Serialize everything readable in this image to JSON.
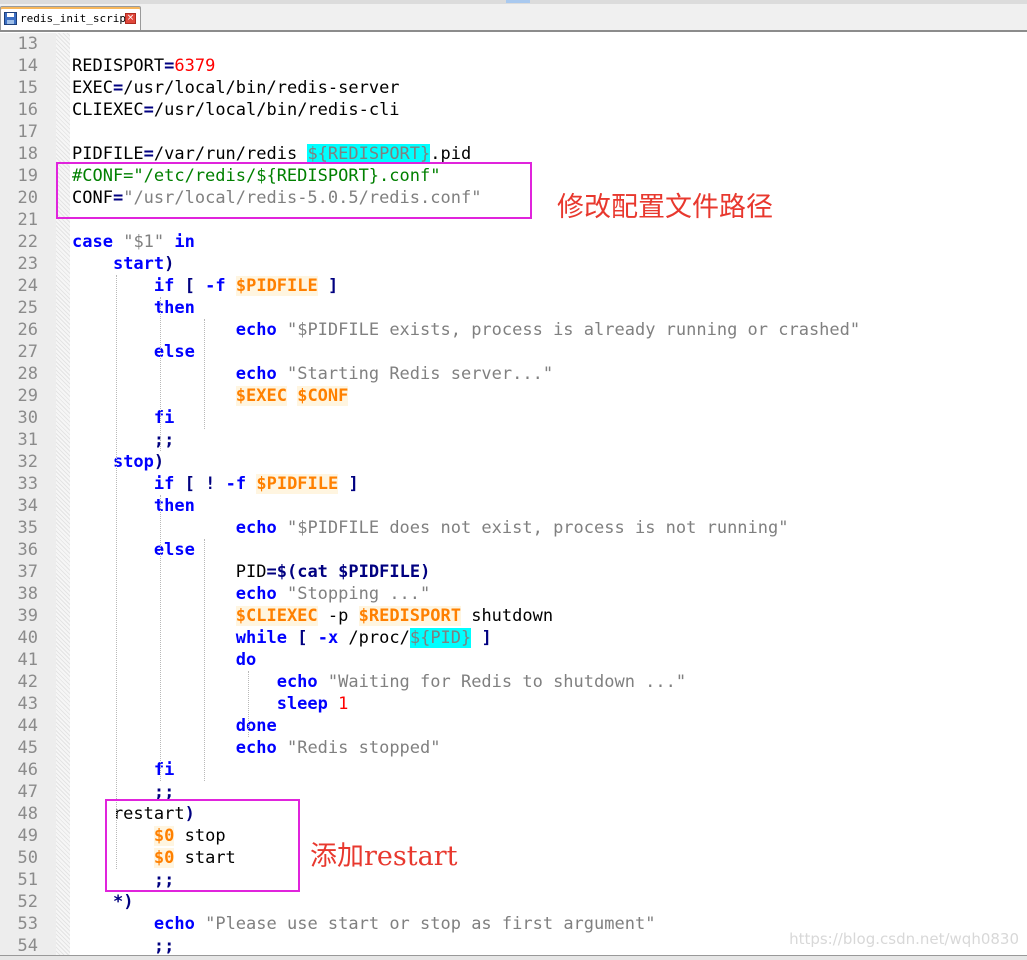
{
  "tab": {
    "title": "redis_init_script",
    "close_glyph": "×"
  },
  "icons": {
    "save": "save-icon",
    "close": "close-icon"
  },
  "lines": [
    {
      "n": "13",
      "tokens": []
    },
    {
      "n": "14",
      "tokens": [
        {
          "t": "REDISPORT"
        },
        {
          "t": "=",
          "c": "op"
        },
        {
          "t": "6379",
          "c": "num"
        }
      ]
    },
    {
      "n": "15",
      "tokens": [
        {
          "t": "EXEC"
        },
        {
          "t": "=",
          "c": "op"
        },
        {
          "t": "/usr/local/bin/redis-server"
        }
      ]
    },
    {
      "n": "16",
      "tokens": [
        {
          "t": "CLIEXEC"
        },
        {
          "t": "=",
          "c": "op"
        },
        {
          "t": "/usr/local/bin/redis-cli"
        }
      ]
    },
    {
      "n": "17",
      "tokens": []
    },
    {
      "n": "18",
      "tokens": [
        {
          "t": "PIDFILE"
        },
        {
          "t": "=",
          "c": "op"
        },
        {
          "t": "/var/run/redis "
        },
        {
          "t": "${REDISPORT}",
          "c": "hl"
        },
        {
          "t": ".pid"
        }
      ]
    },
    {
      "n": "19",
      "tokens": [
        {
          "t": "#CONF=\"/etc/redis/${REDISPORT}.conf\"",
          "c": "cmt"
        }
      ]
    },
    {
      "n": "20",
      "tokens": [
        {
          "t": "CONF"
        },
        {
          "t": "=",
          "c": "op"
        },
        {
          "t": "\"/usr/local/redis-5.0.5/redis.conf\"",
          "c": "str"
        }
      ]
    },
    {
      "n": "21",
      "tokens": []
    },
    {
      "n": "22",
      "tokens": [
        {
          "t": "case",
          "c": "kw"
        },
        {
          "t": " "
        },
        {
          "t": "\"$1\"",
          "c": "str"
        },
        {
          "t": " "
        },
        {
          "t": "in",
          "c": "kw"
        }
      ]
    },
    {
      "n": "23",
      "tokens": [
        {
          "t": "    "
        },
        {
          "t": "start",
          "c": "kw"
        },
        {
          "t": ")",
          "c": "op"
        }
      ]
    },
    {
      "n": "24",
      "tokens": [
        {
          "t": "        "
        },
        {
          "t": "if",
          "c": "kw"
        },
        {
          "t": " "
        },
        {
          "t": "[",
          "c": "op"
        },
        {
          "t": " "
        },
        {
          "t": "-f",
          "c": "kw"
        },
        {
          "t": " "
        },
        {
          "t": "$PIDFILE",
          "c": "var"
        },
        {
          "t": " "
        },
        {
          "t": "]",
          "c": "op"
        }
      ]
    },
    {
      "n": "25",
      "tokens": [
        {
          "t": "        "
        },
        {
          "t": "then",
          "c": "kw"
        }
      ]
    },
    {
      "n": "26",
      "tokens": [
        {
          "t": "                "
        },
        {
          "t": "echo",
          "c": "kw"
        },
        {
          "t": " "
        },
        {
          "t": "\"$PIDFILE exists, process is already running or crashed\"",
          "c": "str"
        }
      ]
    },
    {
      "n": "27",
      "tokens": [
        {
          "t": "        "
        },
        {
          "t": "else",
          "c": "kw"
        }
      ]
    },
    {
      "n": "28",
      "tokens": [
        {
          "t": "                "
        },
        {
          "t": "echo",
          "c": "kw"
        },
        {
          "t": " "
        },
        {
          "t": "\"Starting Redis server...\"",
          "c": "str"
        }
      ]
    },
    {
      "n": "29",
      "tokens": [
        {
          "t": "                "
        },
        {
          "t": "$EXEC",
          "c": "var"
        },
        {
          "t": " "
        },
        {
          "t": "$CONF",
          "c": "var"
        }
      ]
    },
    {
      "n": "30",
      "tokens": [
        {
          "t": "        "
        },
        {
          "t": "fi",
          "c": "kw"
        }
      ]
    },
    {
      "n": "31",
      "tokens": [
        {
          "t": "        "
        },
        {
          "t": ";;",
          "c": "op"
        }
      ]
    },
    {
      "n": "32",
      "tokens": [
        {
          "t": "    "
        },
        {
          "t": "stop",
          "c": "kw"
        },
        {
          "t": ")",
          "c": "op"
        }
      ]
    },
    {
      "n": "33",
      "tokens": [
        {
          "t": "        "
        },
        {
          "t": "if",
          "c": "kw"
        },
        {
          "t": " "
        },
        {
          "t": "[",
          "c": "op"
        },
        {
          "t": " "
        },
        {
          "t": "!",
          "c": "op"
        },
        {
          "t": " "
        },
        {
          "t": "-f",
          "c": "kw"
        },
        {
          "t": " "
        },
        {
          "t": "$PIDFILE",
          "c": "var"
        },
        {
          "t": " "
        },
        {
          "t": "]",
          "c": "op"
        }
      ]
    },
    {
      "n": "34",
      "tokens": [
        {
          "t": "        "
        },
        {
          "t": "then",
          "c": "kw"
        }
      ]
    },
    {
      "n": "35",
      "tokens": [
        {
          "t": "                "
        },
        {
          "t": "echo",
          "c": "kw"
        },
        {
          "t": " "
        },
        {
          "t": "\"$PIDFILE does not exist, process is not running\"",
          "c": "str"
        }
      ]
    },
    {
      "n": "36",
      "tokens": [
        {
          "t": "        "
        },
        {
          "t": "else",
          "c": "kw"
        }
      ]
    },
    {
      "n": "37",
      "tokens": [
        {
          "t": "                "
        },
        {
          "t": "PID"
        },
        {
          "t": "=$(",
          "c": "op"
        },
        {
          "t": "cat",
          "c": "op"
        },
        {
          "t": " "
        },
        {
          "t": "$PIDFILE",
          "c": "op"
        },
        {
          "t": ")",
          "c": "op"
        }
      ]
    },
    {
      "n": "38",
      "tokens": [
        {
          "t": "                "
        },
        {
          "t": "echo",
          "c": "kw"
        },
        {
          "t": " "
        },
        {
          "t": "\"Stopping ...\"",
          "c": "str"
        }
      ]
    },
    {
      "n": "39",
      "tokens": [
        {
          "t": "                "
        },
        {
          "t": "$CLIEXEC",
          "c": "var"
        },
        {
          "t": " -p "
        },
        {
          "t": "$REDISPORT",
          "c": "var"
        },
        {
          "t": " shutdown"
        }
      ]
    },
    {
      "n": "40",
      "tokens": [
        {
          "t": "                "
        },
        {
          "t": "while",
          "c": "kw"
        },
        {
          "t": " "
        },
        {
          "t": "[",
          "c": "op"
        },
        {
          "t": " "
        },
        {
          "t": "-x",
          "c": "kw"
        },
        {
          "t": " /proc/"
        },
        {
          "t": "${PID}",
          "c": "hl"
        },
        {
          "t": " "
        },
        {
          "t": "]",
          "c": "op"
        }
      ]
    },
    {
      "n": "41",
      "tokens": [
        {
          "t": "                "
        },
        {
          "t": "do",
          "c": "kw"
        }
      ]
    },
    {
      "n": "42",
      "tokens": [
        {
          "t": "                    "
        },
        {
          "t": "echo",
          "c": "kw"
        },
        {
          "t": " "
        },
        {
          "t": "\"Waiting for Redis to shutdown ...\"",
          "c": "str"
        }
      ]
    },
    {
      "n": "43",
      "tokens": [
        {
          "t": "                    "
        },
        {
          "t": "sleep",
          "c": "kw"
        },
        {
          "t": " "
        },
        {
          "t": "1",
          "c": "num"
        }
      ]
    },
    {
      "n": "44",
      "tokens": [
        {
          "t": "                "
        },
        {
          "t": "done",
          "c": "kw"
        }
      ]
    },
    {
      "n": "45",
      "tokens": [
        {
          "t": "                "
        },
        {
          "t": "echo",
          "c": "kw"
        },
        {
          "t": " "
        },
        {
          "t": "\"Redis stopped\"",
          "c": "str"
        }
      ]
    },
    {
      "n": "46",
      "tokens": [
        {
          "t": "        "
        },
        {
          "t": "fi",
          "c": "kw"
        }
      ]
    },
    {
      "n": "47",
      "tokens": [
        {
          "t": "        "
        },
        {
          "t": ";;",
          "c": "op"
        }
      ]
    },
    {
      "n": "48",
      "tokens": [
        {
          "t": "    restart"
        },
        {
          "t": ")",
          "c": "op"
        }
      ]
    },
    {
      "n": "49",
      "tokens": [
        {
          "t": "        "
        },
        {
          "t": "$0",
          "c": "var"
        },
        {
          "t": " stop"
        }
      ]
    },
    {
      "n": "50",
      "tokens": [
        {
          "t": "        "
        },
        {
          "t": "$0",
          "c": "var"
        },
        {
          "t": " start"
        }
      ]
    },
    {
      "n": "51",
      "tokens": [
        {
          "t": "        "
        },
        {
          "t": ";;",
          "c": "op"
        }
      ]
    },
    {
      "n": "52",
      "tokens": [
        {
          "t": "    "
        },
        {
          "t": "*)",
          "c": "op"
        }
      ]
    },
    {
      "n": "53",
      "tokens": [
        {
          "t": "        "
        },
        {
          "t": "echo",
          "c": "kw"
        },
        {
          "t": " "
        },
        {
          "t": "\"Please use start or stop as first argument\"",
          "c": "str"
        }
      ]
    },
    {
      "n": "54",
      "tokens": [
        {
          "t": "        "
        },
        {
          "t": ";;",
          "c": "op"
        }
      ]
    }
  ],
  "annotations": {
    "config_path_note": "修改配置文件路径",
    "restart_note": "添加restart"
  },
  "watermark": "https://blog.csdn.net/wqh0830",
  "colors": {
    "keyword": "#0000ff",
    "operator": "#000080",
    "string": "#808080",
    "number": "#ff0000",
    "comment": "#008000",
    "variable": "#ff8000",
    "highlight": "#00ffff",
    "annotation_box": "#e024dc",
    "annotation_text": "#e8382e"
  }
}
